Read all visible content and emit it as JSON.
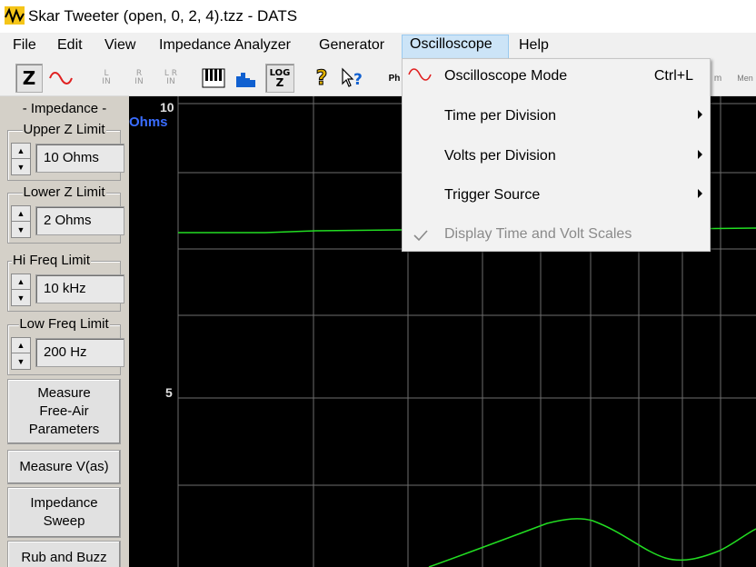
{
  "window": {
    "title": "Skar Tweeter (open, 0, 2, 4).tzz - DATS",
    "app_icon": "dats-waveform-icon"
  },
  "menubar": {
    "items": [
      "File",
      "Edit",
      "View",
      "Impedance Analyzer",
      "Generator",
      "Oscilloscope",
      "Help"
    ],
    "open_item": "Oscilloscope"
  },
  "toolbar": {
    "z_label": "Z",
    "sine_icon": "sine-wave-icon",
    "l_in": [
      "L",
      "IN"
    ],
    "r_in": [
      "R",
      "IN"
    ],
    "lr_in": [
      "L R",
      "IN"
    ],
    "piano_icon": "piano-keys-icon",
    "bars_icon": "histogram-icon",
    "log_label": "LOG",
    "log_sub": "Z",
    "help_icon": "question-mark-icon",
    "context_help_icon": "context-help-icon",
    "partial_label": "Ph",
    "right_partial": [
      "m",
      "Men"
    ]
  },
  "left_panel": {
    "impedance_header": "- Impedance -",
    "groups": [
      {
        "title": "Upper Z Limit",
        "value": "10 Ohms"
      },
      {
        "title": "Lower Z Limit",
        "value": "2 Ohms"
      },
      {
        "title": "Hi Freq Limit",
        "value": "10 kHz"
      },
      {
        "title": "Low Freq Limit",
        "value": "200 Hz"
      }
    ],
    "buttons": [
      "Measure Free-Air Parameters",
      "Measure V(as)",
      "Impedance Sweep",
      "Rub and Buzz"
    ]
  },
  "plot": {
    "y_top_label": "10",
    "y_unit": "Ohms",
    "y_mid_label": "5",
    "colors": {
      "background": "#000000",
      "grid": "#6e6e6e",
      "trace": "#22dd22",
      "unit": "#3a6dff"
    }
  },
  "oscilloscope_menu": {
    "items": [
      {
        "label": "Oscilloscope Mode",
        "shortcut": "Ctrl+L",
        "icon": "sine-wave-icon",
        "submenu": false,
        "enabled": true
      },
      {
        "label": "Time per Division",
        "shortcut": "",
        "submenu": true,
        "enabled": true
      },
      {
        "label": "Volts per Division",
        "shortcut": "",
        "submenu": true,
        "enabled": true
      },
      {
        "label": "Trigger Source",
        "shortcut": "",
        "submenu": true,
        "enabled": true
      },
      {
        "label": "Display Time and Volt Scales",
        "shortcut": "",
        "icon": "checkmark-icon",
        "submenu": false,
        "enabled": false,
        "checked": true
      }
    ]
  }
}
